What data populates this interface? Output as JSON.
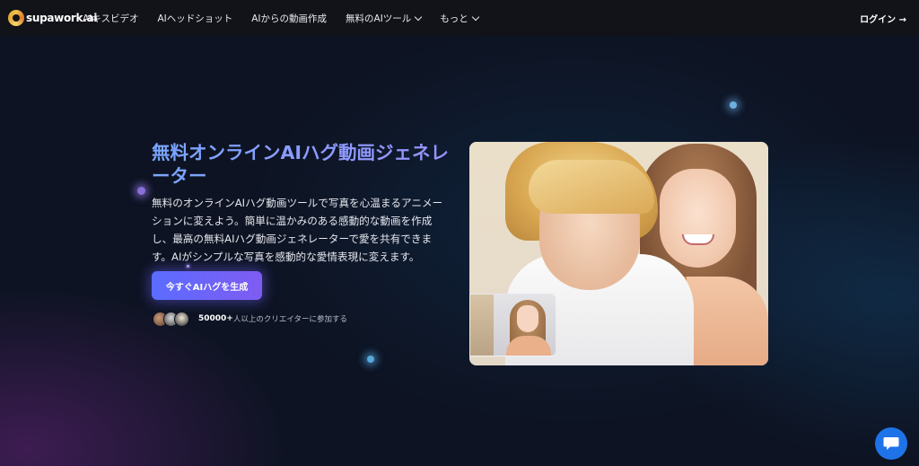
{
  "nav": {
    "logo_text": "supawork.ai",
    "items": [
      {
        "label": "AIキスビデオ",
        "has_dropdown": false
      },
      {
        "label": "AIヘッドショット",
        "has_dropdown": false
      },
      {
        "label": "AIからの動画作成",
        "has_dropdown": false
      },
      {
        "label": "無料のAIツール",
        "has_dropdown": true
      },
      {
        "label": "もっと",
        "has_dropdown": true
      }
    ],
    "login_label": "ログイン →"
  },
  "hero": {
    "title": "無料オンラインAIハグ動画ジェネレーター",
    "description": "無料のオンラインAIハグ動画ツールで写真を心温まるアニメーションに変えよう。簡単に温かみのある感動的な動画を作成し、最高の無料AIハグ動画ジェネレーターで愛を共有できます。AIがシンプルな写真を感動的な愛情表現に変えます。",
    "cta_label": "今すぐAIハグを生成",
    "social_count": "50000+",
    "social_text": "人以上のクリエイターに参加する"
  },
  "colors": {
    "background": "#0d1322",
    "nav_background": "#121318",
    "title_gradient_start": "#7aa6ff",
    "title_gradient_end": "#9a92ff",
    "cta_gradient_start": "#5b6cff",
    "cta_gradient_end": "#7f5cf2",
    "chat_button": "#1e73e8"
  },
  "icons": {
    "chat": "chat-bubble-icon",
    "dropdown": "chevron-down-icon"
  }
}
